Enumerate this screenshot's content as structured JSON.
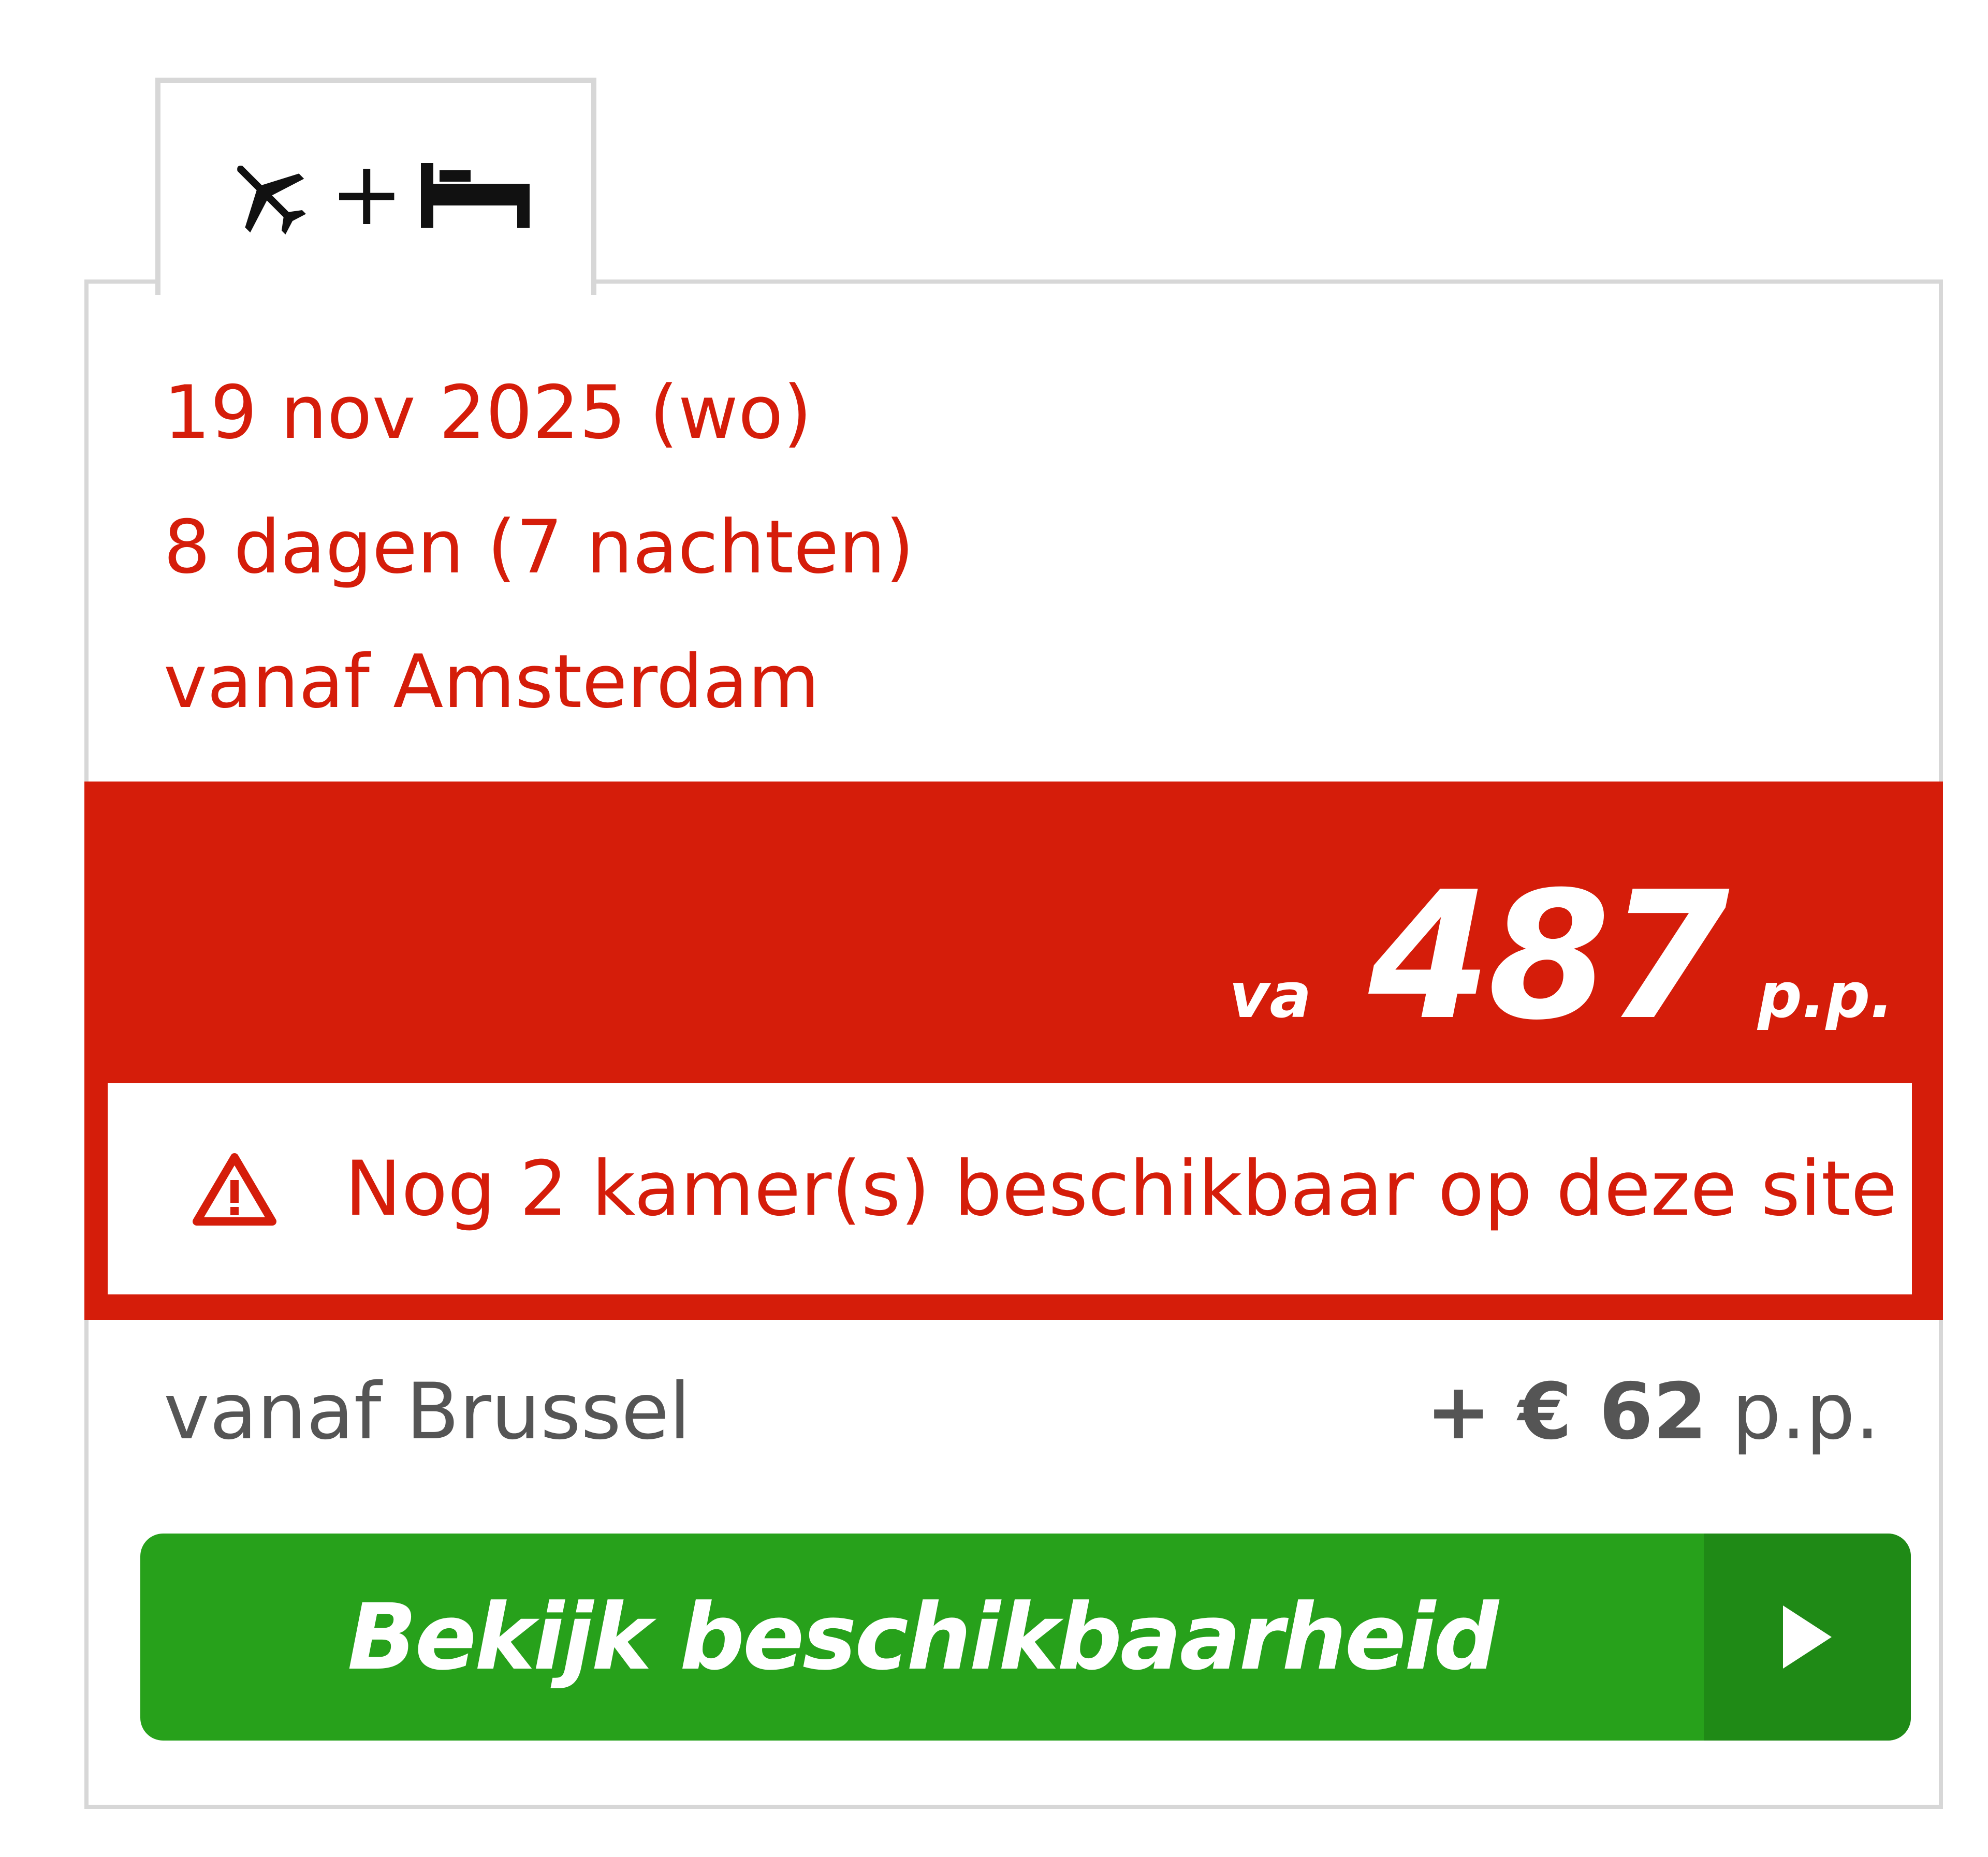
{
  "tab": {
    "icons": [
      "plane-icon",
      "bed-icon"
    ],
    "plus": "+"
  },
  "trip": {
    "date": "19 nov 2025 (wo)",
    "duration": "8 dagen (7 nachten)",
    "departure": "vanaf Amsterdam"
  },
  "price": {
    "prefix": "va",
    "amount": "487",
    "suffix": "p.p."
  },
  "availability": {
    "icon": "warning-icon",
    "text": "Nog 2 kamer(s) beschikbaar op deze site"
  },
  "alternative": {
    "departure": "vanaf Brussel",
    "surcharge": "+ € 62",
    "suffix": "p.p."
  },
  "cta": {
    "label": "Bekijk beschikbaarheid",
    "icon": "chevron-right-icon"
  },
  "colors": {
    "accent_red": "#d51d0a",
    "button_green": "#27a11b",
    "button_green_dark": "#1f8a16",
    "border_gray": "#d7d7d7",
    "muted_text": "#555555"
  }
}
